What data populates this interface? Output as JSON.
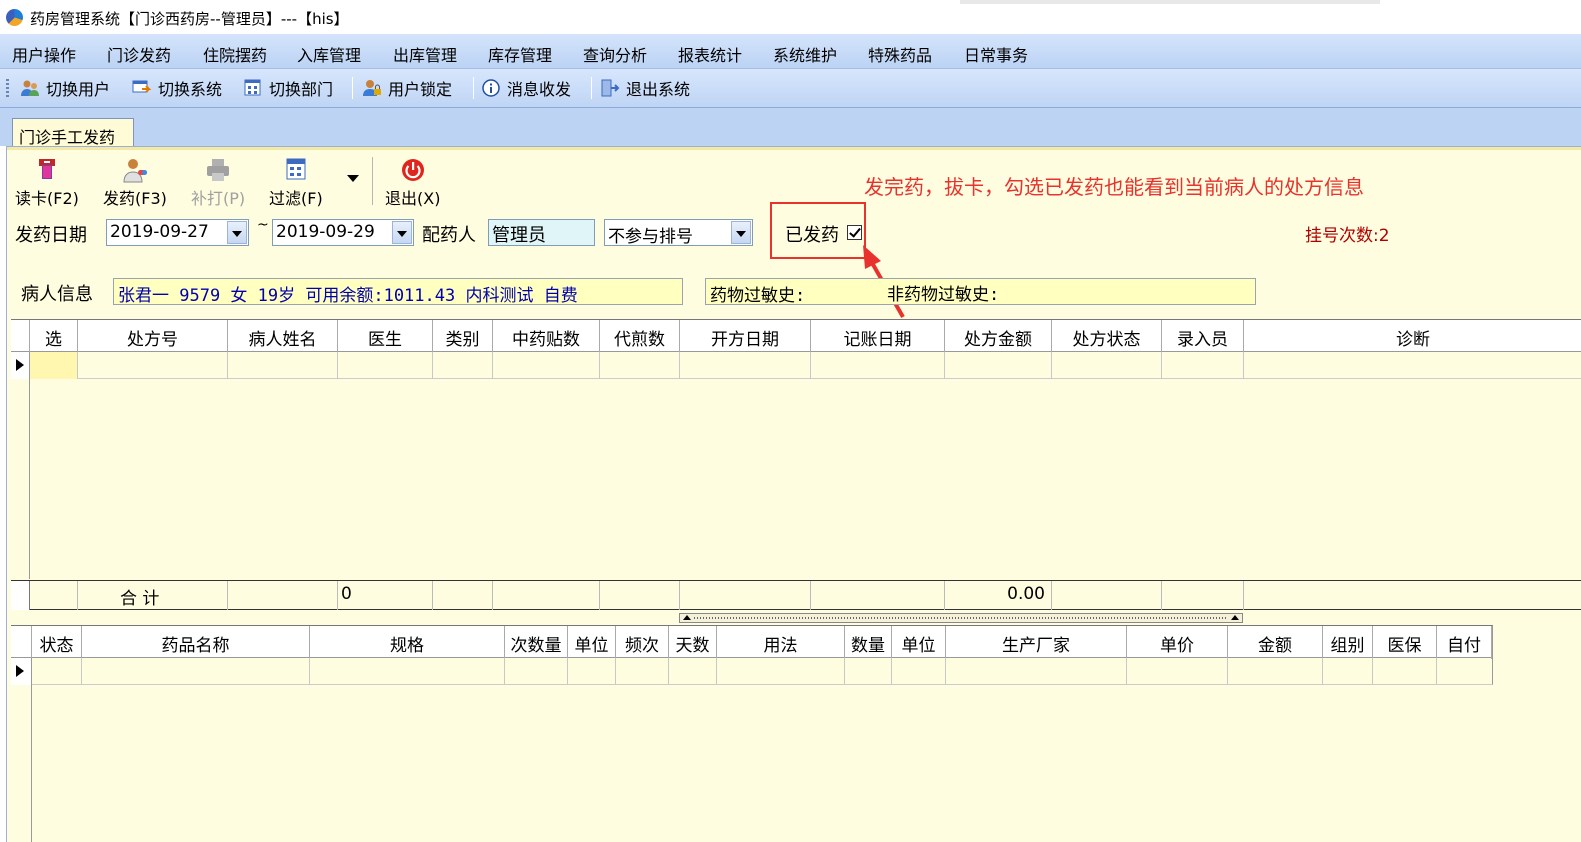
{
  "window": {
    "title": "药房管理系统【门诊西药房--管理员】---【his】"
  },
  "menu": [
    "用户操作",
    "门诊发药",
    "住院摆药",
    "入库管理",
    "出库管理",
    "库存管理",
    "查询分析",
    "报表统计",
    "系统维护",
    "特殊药品",
    "日常事务"
  ],
  "toolbar": {
    "switch_user": "切换用户",
    "switch_system": "切换系统",
    "switch_dept": "切换部门",
    "user_lock": "用户锁定",
    "message": "消息收发",
    "exit_system": "退出系统"
  },
  "tab": {
    "label": "门诊手工发药"
  },
  "actions": {
    "read_card": "读卡(F2)",
    "dispense": "发药(F3)",
    "reprint": "补打(P)",
    "filter": "过滤(F)",
    "exit": "退出(X)"
  },
  "annotation": "发完药，拔卡，勾选已发药也能看到当前病人的处方信息",
  "filters": {
    "date_label": "发药日期",
    "date_from": "2019-09-27",
    "tilde": "~",
    "date_to": "2019-09-29",
    "dispenser_label": "配药人",
    "dispenser": "管理员",
    "queue_option": "不参与排号",
    "dispensed_label": "已发药",
    "dispensed_checked": true,
    "registration_count": "挂号次数:2"
  },
  "patient": {
    "label": "病人信息",
    "info": "张君一  9579  女  19岁  可用余额:1011.43  内科测试  自费",
    "drug_allergy_label": "药物过敏史:",
    "non_drug_allergy_label": "非药物过敏史:"
  },
  "prescription_table": {
    "columns": [
      "选",
      "处方号",
      "病人姓名",
      "医生",
      "类别",
      "中药贴数",
      "代煎数",
      "开方日期",
      "记账日期",
      "处方金额",
      "处方状态",
      "录入员",
      "诊断"
    ],
    "summary": {
      "label": "合  计",
      "count": "0",
      "amount": "0.00"
    }
  },
  "detail_table": {
    "columns": [
      "状态",
      "药品名称",
      "规格",
      "次数量",
      "单位",
      "频次",
      "天数",
      "用法",
      "数量",
      "单位",
      "生产厂家",
      "单价",
      "金额",
      "组别",
      "医保",
      "自付"
    ]
  }
}
